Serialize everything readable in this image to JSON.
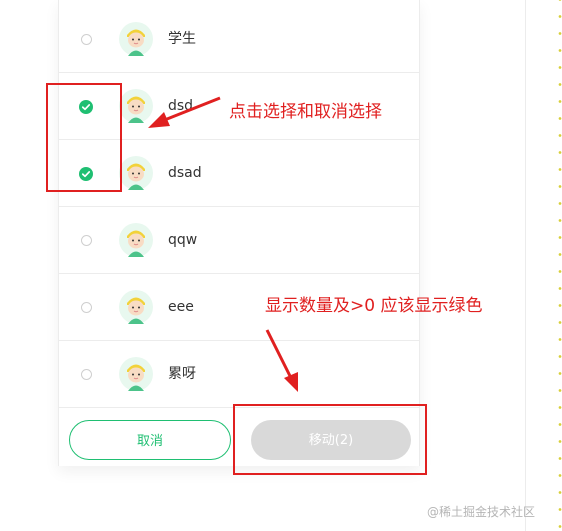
{
  "members": [
    {
      "name": "学生",
      "checked": false
    },
    {
      "name": "dsd",
      "checked": true
    },
    {
      "name": "dsad",
      "checked": true
    },
    {
      "name": "qqw",
      "checked": false
    },
    {
      "name": "eee",
      "checked": false
    },
    {
      "name": "累呀",
      "checked": false
    }
  ],
  "footer": {
    "cancel_label": "取消",
    "move_label": "移动(2)"
  },
  "annotations": {
    "toggle_note": "点击选择和取消选择",
    "count_note": "显示数量及>0 应该显示绿色"
  },
  "watermark": "@稀土掘金技术社区",
  "colors": {
    "accent": "#1fbf72",
    "annotation": "#e02020",
    "disabled_button": "#d9d9d9"
  }
}
